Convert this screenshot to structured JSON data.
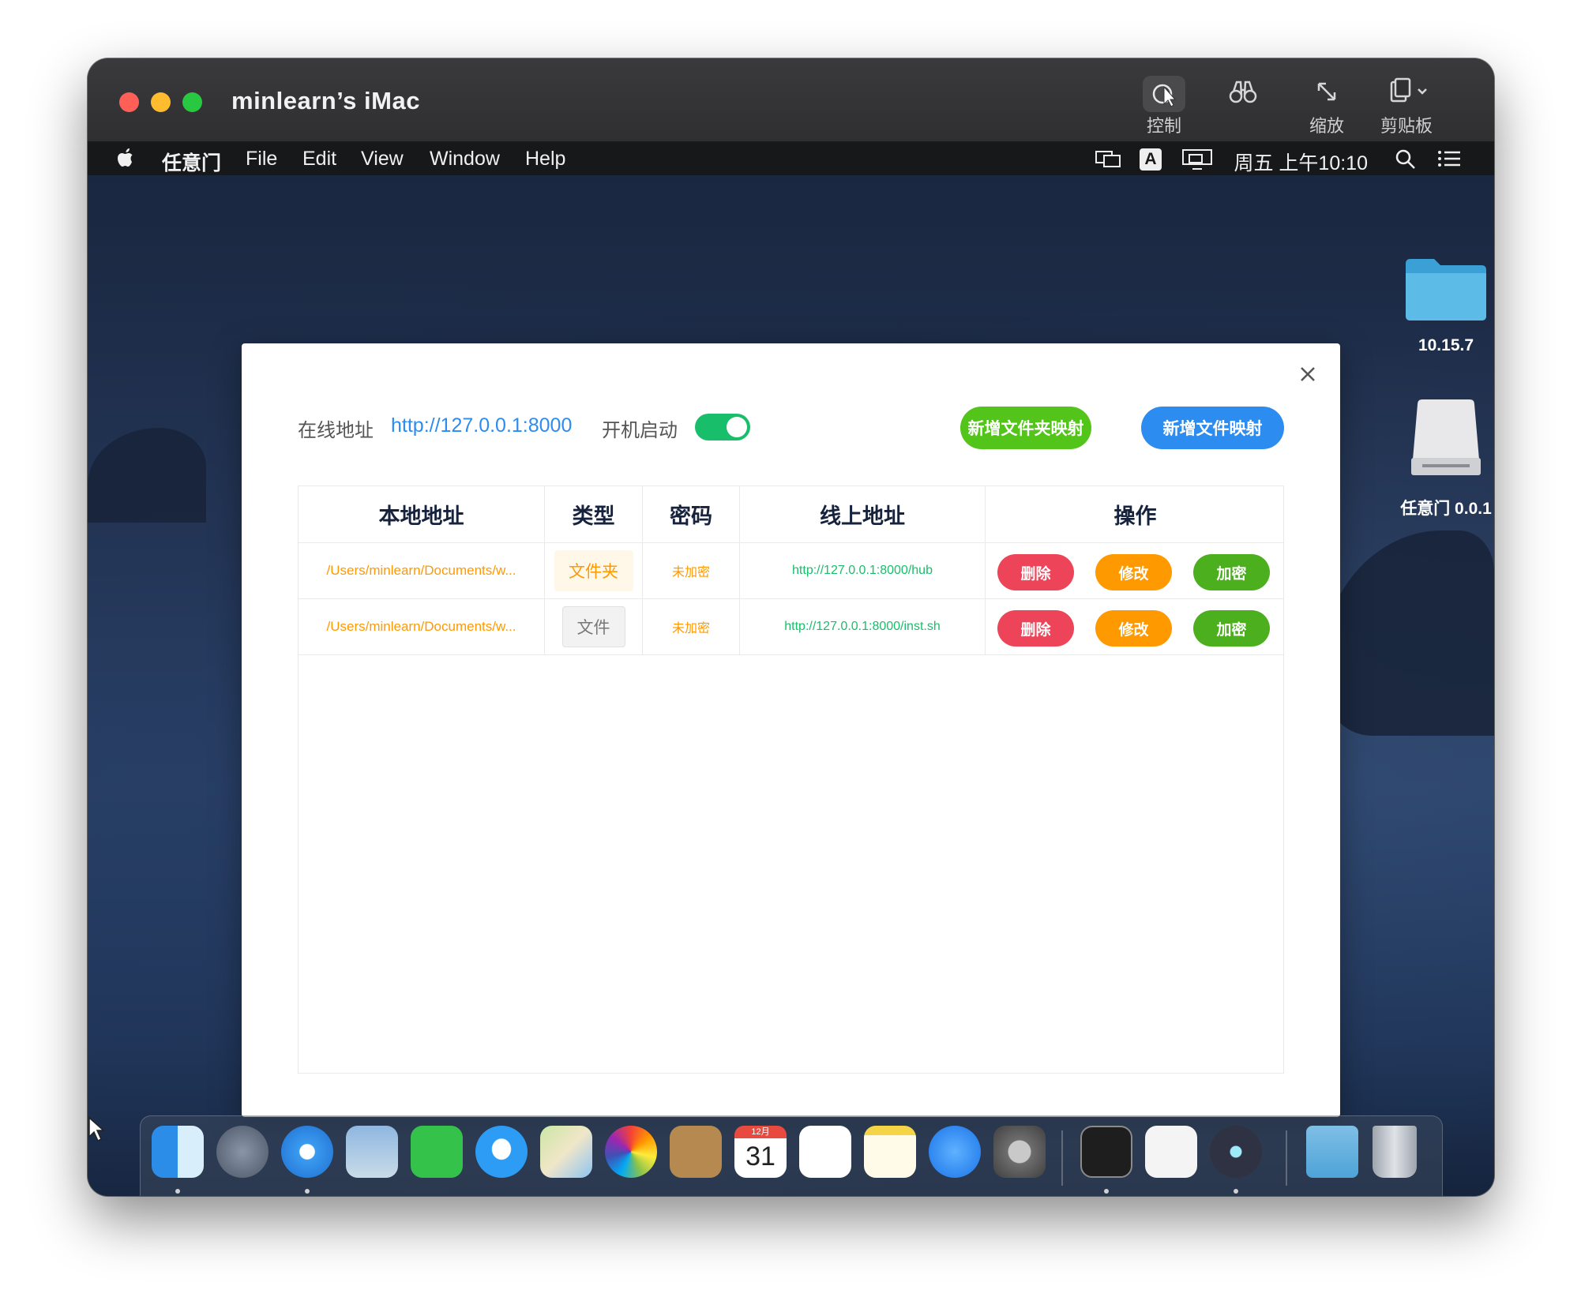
{
  "window": {
    "title": "minlearn’s iMac",
    "tools": [
      {
        "name": "control",
        "label": "控制",
        "icon": "cursor-control-icon"
      },
      {
        "name": "binoculars",
        "label": "",
        "icon": "binoculars-icon"
      },
      {
        "name": "zoom",
        "label": "缩放",
        "icon": "resize-arrows-icon"
      },
      {
        "name": "clipboard",
        "label": "剪贴板",
        "icon": "clipboard-icon"
      }
    ]
  },
  "menubar": {
    "app_name": "任意门",
    "items": [
      "File",
      "Edit",
      "View",
      "Window",
      "Help"
    ],
    "clock": "周五 上午10:10",
    "input_method": "A"
  },
  "desktop": {
    "items": [
      {
        "label": "10.15.7",
        "icon": "folder-icon"
      },
      {
        "label": "任意门 0.0.1",
        "icon": "disk-icon"
      }
    ]
  },
  "dialog": {
    "online_label": "在线地址",
    "online_url": "http://127.0.0.1:8000",
    "autostart_label": "开机启动",
    "autostart_on": true,
    "add_folder_button": "新增文件夹映射",
    "add_file_button": "新增文件映射",
    "table": {
      "headers": [
        "本地地址",
        "类型",
        "密码",
        "线上地址",
        "操作"
      ],
      "rows": [
        {
          "path": "/Users/minlearn/Documents/w...",
          "type": "文件夹",
          "password": "未加密",
          "url": "http://127.0.0.1:8000/hub",
          "actions": [
            "删除",
            "修改",
            "加密"
          ]
        },
        {
          "path": "/Users/minlearn/Documents/w...",
          "type": "文件",
          "password": "未加密",
          "url": "http://127.0.0.1:8000/inst.sh",
          "actions": [
            "删除",
            "修改",
            "加密"
          ]
        }
      ]
    }
  },
  "dock": {
    "apps": [
      "finder-icon",
      "launchpad-icon",
      "safari-icon",
      "mail-icon",
      "facetime-icon",
      "messages-icon",
      "maps-icon",
      "photos-icon",
      "contacts-icon",
      "calendar-icon",
      "reminders-icon",
      "notes-icon",
      "app-store-icon",
      "system-preferences-icon",
      "terminal-icon",
      "textedit-icon",
      "electron-icon",
      "downloads-folder-icon",
      "trash-icon"
    ],
    "calendar_month": "12月",
    "calendar_day": "31"
  },
  "colors": {
    "link_blue": "#2d8cf0",
    "success_green": "#19be6b",
    "warning_orange": "#ff9900",
    "error_red": "#ed4459"
  }
}
